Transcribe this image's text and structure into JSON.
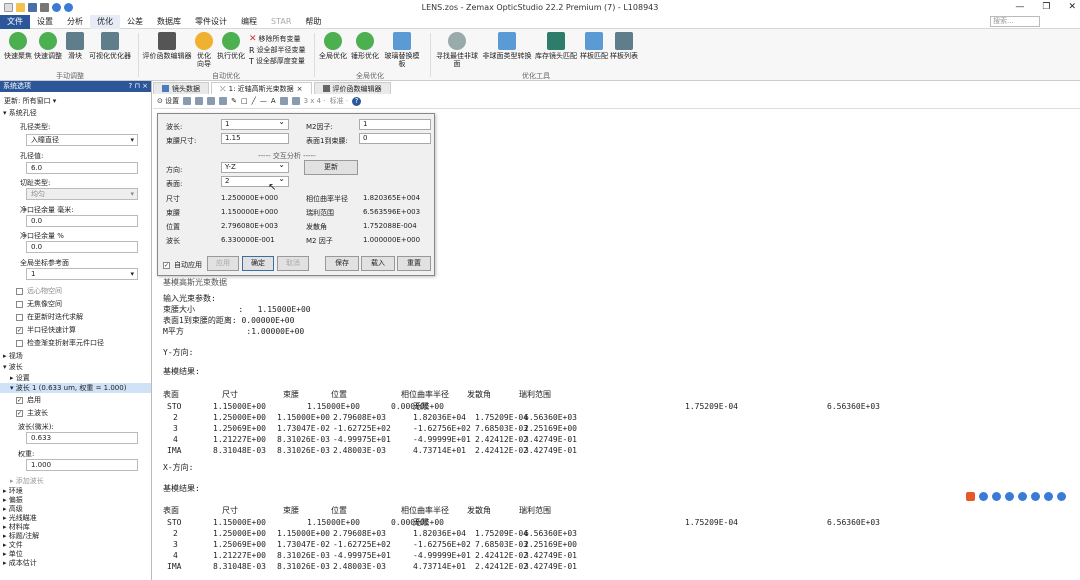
{
  "window": {
    "title": "LENS.zos - Zemax OpticStudio 22.2    Premium (7) - L108943",
    "min": "—",
    "max": "❐",
    "close": "✕"
  },
  "menu": [
    "文件",
    "设置",
    "分析",
    "优化",
    "公差",
    "数据库",
    "零件设计",
    "编程",
    "STAR",
    "帮助"
  ],
  "search_placeholder": "搜索...",
  "ribbon": {
    "buttons": [
      {
        "label": "快速聚焦",
        "color": "#4caf50"
      },
      {
        "label": "快速调整",
        "color": "#4caf50"
      },
      {
        "label": "滑块",
        "color": "#607d8b"
      },
      {
        "label": "可视化优化器",
        "color": "#607d8b"
      },
      {
        "label": "评价函数编辑器",
        "color": "#555"
      },
      {
        "label": "优化\n向导",
        "color": "#f0b030"
      },
      {
        "label": "执行优化",
        "color": "#4caf50"
      },
      {
        "label": "全局优化",
        "color": "#4caf50"
      },
      {
        "label": "锤形优化",
        "color": "#4caf50"
      },
      {
        "label": "玻璃替换模板",
        "color": "#5b9bd5"
      },
      {
        "label": "寻找最佳非球面",
        "color": "#9aa"
      },
      {
        "label": "非球面类型转换",
        "color": "#5b9bd5"
      },
      {
        "label": "库存镜头匹配",
        "color": "#2e7d6b"
      },
      {
        "label": "样板匹配",
        "color": "#5b9bd5"
      },
      {
        "label": "样板列表",
        "color": "#607d8b"
      }
    ],
    "small": [
      "移除所有变量",
      "设全部半径变量",
      "设全部厚度变量"
    ],
    "groups": [
      "手动调整",
      "自动优化",
      "全局优化",
      "优化工具"
    ]
  },
  "left_panel": {
    "header": "系统选项",
    "pin": "? ⊓ ×",
    "update": "更新: 所有窗口 ▾",
    "aperture": "系统孔径",
    "aperture_type_label": "孔径类型:",
    "aperture_type": "入瞳直径",
    "aperture_value_label": "孔径值:",
    "aperture_value": "6.0",
    "apod_label": "切趾类型:",
    "apod": "均匀",
    "clear_mm_label": "净口径余量 毫米:",
    "clear_mm": "0.0",
    "clear_pct_label": "净口径余量 %",
    "clear_pct": "0.0",
    "global_ref_label": "全局坐标参考面",
    "global_ref": "1",
    "checks": [
      {
        "label": "远心物空间",
        "checked": false,
        "disabled": true
      },
      {
        "label": "无焦像空间",
        "checked": false,
        "disabled": false
      },
      {
        "label": "在更新时迭代求解",
        "checked": false,
        "disabled": false
      },
      {
        "label": "半口径快速计算",
        "checked": true,
        "disabled": false
      },
      {
        "label": "检查渐变折射率元件口径",
        "checked": false,
        "disabled": false
      }
    ],
    "field": "视场",
    "wave": "波长",
    "settings": "设置",
    "wave1": "波长 1 (0.633 um, 权重 = 1.000)",
    "enable": "启用",
    "primary": "主波长",
    "wavelength_label": "波长(微米):",
    "wavelength": "0.633",
    "weight_label": "权重:",
    "weight": "1.000",
    "add_wave": "添加波长",
    "tail": [
      "环境",
      "偏振",
      "高级",
      "光线瞄准",
      "材料库",
      "标题/注解",
      "文件",
      "单位",
      "成本估计"
    ]
  },
  "tabs": [
    {
      "label": "镜头数据"
    },
    {
      "label": "1: 近轴高斯光束数据"
    },
    {
      "label": "评价函数编辑器"
    }
  ],
  "toolbar": {
    "settings": "设置",
    "extra": "3 x 4 ·",
    "std": "标准 ·"
  },
  "dialog": {
    "wavelength_label": "波长:",
    "wavelength": "1",
    "m2_label": "M2因子:",
    "m2": "1",
    "waist_size_label": "束腰尺寸:",
    "waist_size": "1.15",
    "surf1_label": "表面1到束腰:",
    "surf1": "0",
    "interactive": "----- 交互分析 -----",
    "direction_label": "方向:",
    "direction": "Y-Z",
    "update_btn": "更新",
    "surface_label": "表面:",
    "surface": "2",
    "results": [
      {
        "a": "尺寸",
        "av": "1.250000E+000",
        "b": "相位曲率半径",
        "bv": "1.820365E+004"
      },
      {
        "a": "束腰",
        "av": "1.150000E+000",
        "b": "瑞利范围",
        "bv": "6.563596E+003"
      },
      {
        "a": "位置",
        "av": "2.796080E+003",
        "b": "发散角",
        "bv": "1.752088E-004"
      },
      {
        "a": "波长",
        "av": "6.330000E-001",
        "b": "M2 因子",
        "bv": "1.000000E+000"
      }
    ],
    "auto_apply": "自动应用",
    "apply": "应用",
    "ok": "确定",
    "cancel": "取消",
    "save": "保存",
    "load": "载入",
    "reset": "重置"
  },
  "report": {
    "faded": "基模高斯光束数据",
    "input_header": "输入光束参数:",
    "waist_line": "束腰大小         :   1.15000E+00",
    "dist_line": "表面1到束腰的距离: 0.00000E+00",
    "m2_line": "M平方             :1.00000E+00",
    "y_dir": "Y-方向:",
    "x_dir": "X-方向:",
    "result_header": "基模结果:",
    "columns": [
      "表面",
      "尺寸",
      "束腰",
      "位置",
      "相位曲率半径",
      "发散角",
      "瑞利范围"
    ],
    "y_rows": [
      {
        "s": "STO",
        "size": "1.15000E+00",
        "waist": "1.15000E+00",
        "pos": "0.00000E+00",
        "roc": "无限",
        "div": "1.75209E-04",
        "ray": "6.56360E+03"
      },
      {
        "s": "2",
        "size": "1.25000E+00",
        "waist": "1.15000E+00",
        "pos": "2.79608E+03",
        "roc": "1.82036E+04",
        "div": "1.75209E-04",
        "ray": "6.56360E+03"
      },
      {
        "s": "3",
        "size": "1.25069E+00",
        "waist": "1.73047E-02",
        "pos": "-1.62725E+02",
        "roc": "-1.62756E+02",
        "div": "7.68503E-03",
        "ray": "2.25169E+00"
      },
      {
        "s": "4",
        "size": "1.21227E+00",
        "waist": "8.31026E-03",
        "pos": "-4.99975E+01",
        "roc": "-4.99999E+01",
        "div": "2.42412E-02",
        "ray": "3.42749E-01"
      },
      {
        "s": "IMA",
        "size": "8.31048E-03",
        "waist": "8.31026E-03",
        "pos": "2.48003E-03",
        "roc": "4.73714E+01",
        "div": "2.42412E-02",
        "ray": "3.42749E-01"
      }
    ],
    "x_rows": [
      {
        "s": "STO",
        "size": "1.15000E+00",
        "waist": "1.15000E+00",
        "pos": "0.00000E+00",
        "roc": "无限",
        "div": "1.75209E-04",
        "ray": "6.56360E+03"
      },
      {
        "s": "2",
        "size": "1.25000E+00",
        "waist": "1.15000E+00",
        "pos": "2.79608E+03",
        "roc": "1.82036E+04",
        "div": "1.75209E-04",
        "ray": "6.56360E+03"
      },
      {
        "s": "3",
        "size": "1.25069E+00",
        "waist": "1.73047E-02",
        "pos": "-1.62725E+02",
        "roc": "-1.62756E+02",
        "div": "7.68503E-03",
        "ray": "2.25169E+00"
      },
      {
        "s": "4",
        "size": "1.21227E+00",
        "waist": "8.31026E-03",
        "pos": "-4.99975E+01",
        "roc": "-4.99999E+01",
        "div": "2.42412E-02",
        "ray": "3.42749E-01"
      },
      {
        "s": "IMA",
        "size": "8.31048E-03",
        "waist": "8.31026E-03",
        "pos": "2.48003E-03",
        "roc": "4.73714E+01",
        "div": "2.42412E-02",
        "ray": "3.42749E-01"
      }
    ]
  }
}
